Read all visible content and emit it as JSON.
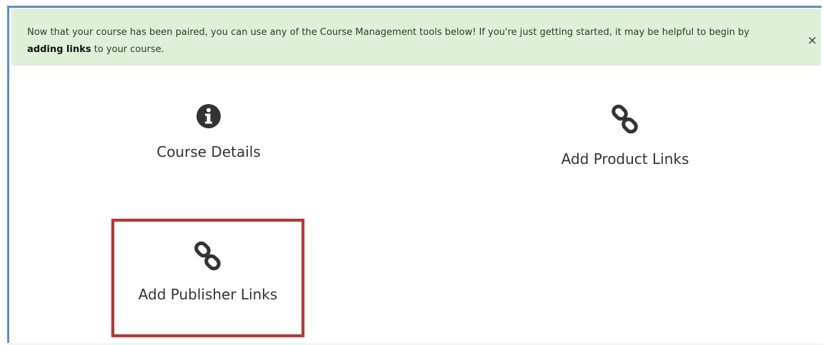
{
  "alert": {
    "text_before": "Now that your course has been paired, you can use any of the Course Management tools below! If you're just getting started, it may be helpful to begin by ",
    "text_bold": "adding links",
    "text_after": " to your course.",
    "close_label": "×"
  },
  "tiles": [
    {
      "label": "Course Details",
      "icon": "info-circle-icon"
    },
    {
      "label": "Add Product Links",
      "icon": "link-icon"
    },
    {
      "label": "Add Publisher Links",
      "icon": "link-icon"
    }
  ],
  "colors": {
    "alert_background": "#dff0d8",
    "frame_border": "#5b8fc9",
    "highlight_border": "#b03a3a",
    "icon_color": "#333333"
  }
}
